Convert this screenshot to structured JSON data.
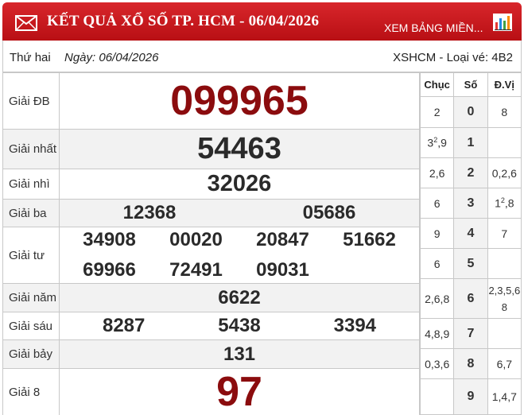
{
  "header": {
    "title": "KẾT QUẢ XỔ SỐ TP. HCM - 06/04/2026",
    "link": "XEM BẢNG MIỀN...",
    "icons": [
      "mail-icon",
      "bar-chart-icon"
    ],
    "bg_color": "#c8161c"
  },
  "subheader": {
    "day": "Thứ hai",
    "date": "Ngày: 06/04/2026",
    "right": "XSHCM - Loại vé: 4B2"
  },
  "prizes": {
    "db": {
      "label": "Giải ĐB",
      "numbers": [
        "099965"
      ]
    },
    "nhat": {
      "label": "Giải nhất",
      "numbers": [
        "54463"
      ]
    },
    "nhi": {
      "label": "Giải nhì",
      "numbers": [
        "32026"
      ]
    },
    "ba": {
      "label": "Giải ba",
      "numbers": [
        "12368",
        "05686"
      ]
    },
    "tu": {
      "label": "Giải tư",
      "numbers": [
        "34908",
        "00020",
        "20847",
        "51662",
        "69966",
        "72491",
        "09031"
      ]
    },
    "nam": {
      "label": "Giải năm",
      "numbers": [
        "6622"
      ]
    },
    "sau": {
      "label": "Giải sáu",
      "numbers": [
        "8287",
        "5438",
        "3394"
      ]
    },
    "bay": {
      "label": "Giải bảy",
      "numbers": [
        "131"
      ]
    },
    "tam": {
      "label": "Giải 8",
      "numbers": [
        "97"
      ]
    }
  },
  "loto": {
    "headers": [
      "Chục",
      "Số",
      "Đ.Vị"
    ],
    "rows": [
      {
        "chuc": "2",
        "so": "0",
        "dv": "8"
      },
      {
        "chuc": "3",
        "chuc_sup": "2",
        "chuc_after": ",9",
        "so": "1",
        "dv": ""
      },
      {
        "chuc": "2,6",
        "so": "2",
        "dv": "0,2,6"
      },
      {
        "chuc": "6",
        "so": "3",
        "dv": "1",
        "dv_sup": "2",
        "dv_after": ",8"
      },
      {
        "chuc": "9",
        "so": "4",
        "dv": "7"
      },
      {
        "chuc": "6",
        "so": "5",
        "dv": ""
      },
      {
        "chuc": "2,6,8",
        "so": "6",
        "dv": "2,3,5,6",
        "dv_line2": "8"
      },
      {
        "chuc": "4,8,9",
        "so": "7",
        "dv": ""
      },
      {
        "chuc": "0,3,6",
        "so": "8",
        "dv": "6,7"
      },
      {
        "chuc": "",
        "so": "9",
        "dv": "1,4,7"
      }
    ]
  },
  "colors": {
    "accent_red": "#8b0c0e",
    "border": "#c8c8c8",
    "row_alt": "#f2f2f2"
  }
}
